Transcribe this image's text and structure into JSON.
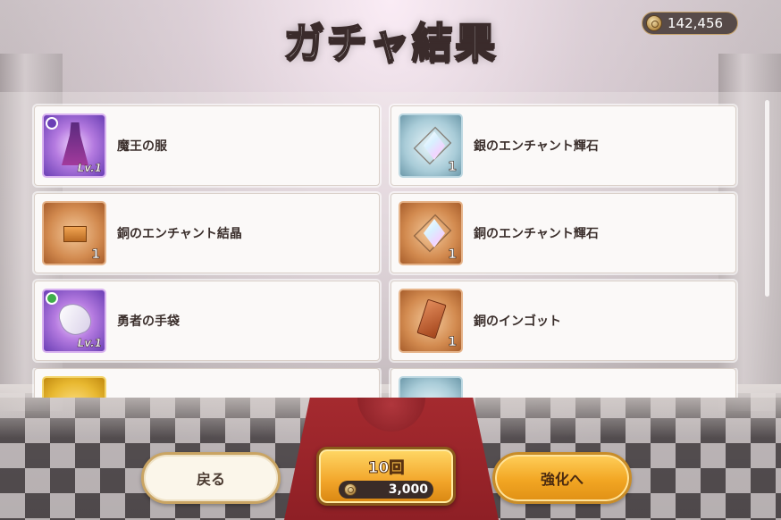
{
  "header": {
    "title": "ガチャ結果",
    "currency": {
      "icon": "coin-icon",
      "value": "142,456"
    }
  },
  "results": [
    {
      "name": "魔王の服",
      "icon": "robe-icon",
      "rarity": "purple",
      "level": "Lv.1",
      "quantity": ""
    },
    {
      "name": "銀のエンチャント輝石",
      "icon": "silver-gem-icon",
      "rarity": "silver",
      "level": "",
      "quantity": "1"
    },
    {
      "name": "銅のエンチャント結晶",
      "icon": "bronze-crystal-icon",
      "rarity": "bronze",
      "level": "",
      "quantity": "1"
    },
    {
      "name": "銅のエンチャント輝石",
      "icon": "bronze-gem-icon",
      "rarity": "bronze",
      "level": "",
      "quantity": "1"
    },
    {
      "name": "勇者の手袋",
      "icon": "glove-icon",
      "rarity": "purple",
      "level": "Lv.1",
      "quantity": ""
    },
    {
      "name": "銅のインゴット",
      "icon": "ingot-icon",
      "rarity": "bronze",
      "level": "",
      "quantity": "1"
    },
    {
      "name": "",
      "icon": "gold-item-icon",
      "rarity": "gold",
      "level": "",
      "quantity": ""
    },
    {
      "name": "",
      "icon": "silver-item-icon",
      "rarity": "silver",
      "level": "",
      "quantity": ""
    }
  ],
  "buttons": {
    "back": "戻る",
    "gacha_count": "10回",
    "gacha_cost": "3,000",
    "enhance": "強化へ"
  },
  "colors": {
    "accent_gold": "#f2a623",
    "card_bg": "#fbf9f8",
    "text": "#3b2f2c"
  }
}
